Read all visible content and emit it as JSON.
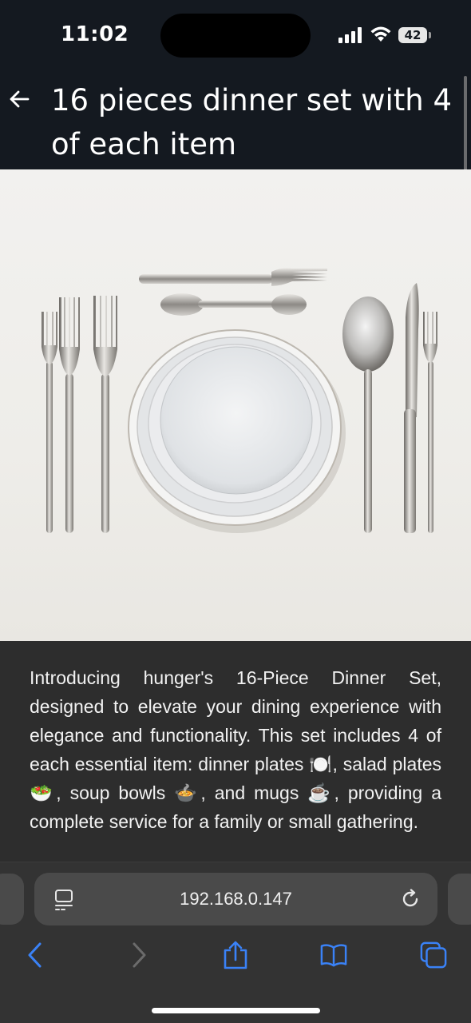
{
  "status_bar": {
    "time": "11:02",
    "battery": "42"
  },
  "header": {
    "title": "16 pieces dinner set with 4 of each item",
    "back_icon": "arrow-left-icon"
  },
  "product": {
    "image_description_icon": "dinner-set-photo",
    "description": "Introducing hunger's 16-Piece Dinner Set, designed to elevate your dining experience with elegance and functionality. This set includes 4 of each essential item: dinner plates 🍽️, salad plates 🥗, soup bowls 🍲, and mugs ☕, providing a complete service for a family or small gathering."
  },
  "browser": {
    "url": "192.168.0.147",
    "toolbar": [
      "back-icon",
      "forward-icon",
      "share-icon",
      "bookmarks-icon",
      "tabs-icon"
    ]
  },
  "colors": {
    "header_bg": "#141920",
    "page_bg": "#2d2d2d",
    "accent": "#3a82f7"
  }
}
